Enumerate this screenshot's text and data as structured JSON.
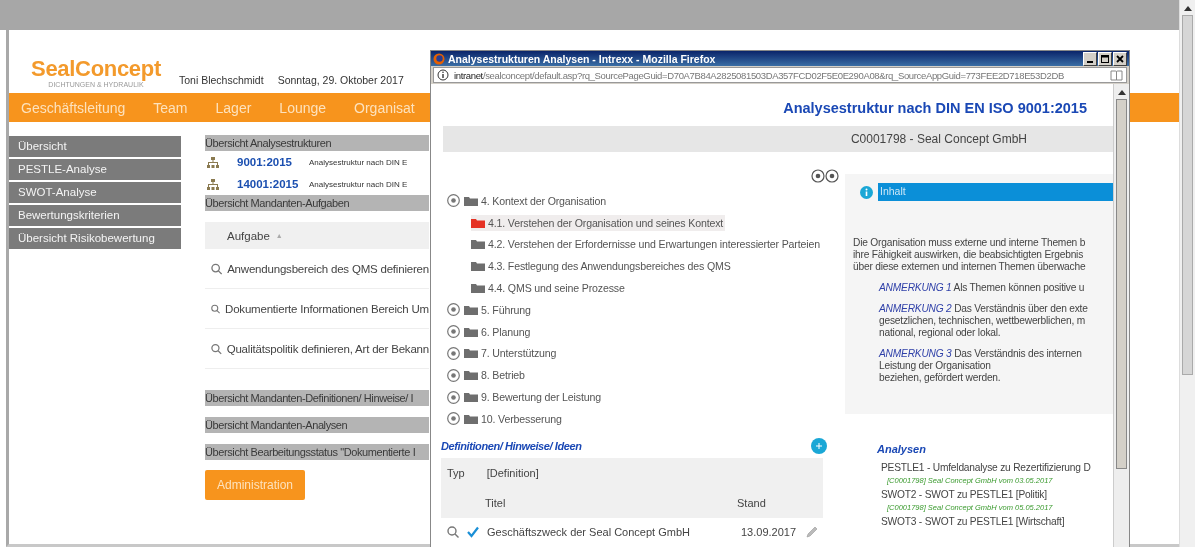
{
  "page": {
    "logo": {
      "name": "SealConcept",
      "tagline": "DICHTUNGEN & HYDRAULIK"
    },
    "user": "Toni Blechschmidt",
    "date": "Sonntag, 29. Oktober 2017",
    "nav": [
      "Geschäftsleitung",
      "Team",
      "Lager",
      "Lounge",
      "Organisat"
    ],
    "sidebar": [
      "Übersicht",
      "PESTLE-Analyse",
      "SWOT-Analyse",
      "Bewertungskriterien",
      "Übersicht Risikobewertung"
    ],
    "structures_header": "Übersicht Analysestrukturen",
    "structures": [
      {
        "code": "9001:2015",
        "description": "Analysestruktur nach DIN E"
      },
      {
        "code": "14001:2015",
        "description": "Analysestruktur nach DIN E"
      }
    ],
    "tasks_header": "Übersicht Mandanten-Aufgaben",
    "tasks_table": {
      "column": "Aufgabe",
      "sort_mark": "▲",
      "rows": [
        "Anwendungsbereich des QMS definieren",
        "Dokumentierte Informationen Bereich Um",
        "Qualitätspolitik definieren, Art der Bekann"
      ]
    },
    "more_headers": [
      "Übersicht Mandanten-Definitionen/ Hinweise/ I",
      "Übersicht Mandanten-Analysen",
      "Übersicht Bearbeitungsstatus \"Dokumentierte I"
    ],
    "admin_button": "Administration"
  },
  "popup": {
    "title": "Analysestrukturen Analysen - Intrexx - Mozilla Firefox",
    "url": "**intranet**/sealconcept/default.asp?rq_SourcePageGuid=D70A7B84A2825081503DA357FCD02F5E0E290A08&rq_SourceAppGuid=773FEE2D718E53D2DB",
    "heading": "Analysestruktur nach DIN EN ISO 9001:2015",
    "client": "C0001798 - Seal Concept GmbH",
    "tree": [
      {
        "label": "4. Kontext der Organisation",
        "selected": false,
        "children": [
          {
            "label": "4.1. Verstehen der Organisation und seines Kontext",
            "selected": true
          },
          {
            "label": "4.2. Verstehen der Erfordernisse und Erwartungen interessierter Parteien",
            "selected": false
          },
          {
            "label": "4.3. Festlegung des Anwendungsbereiches des QMS",
            "selected": false
          },
          {
            "label": "4.4. QMS und seine Prozesse",
            "selected": false
          }
        ]
      },
      {
        "label": "5. Führung",
        "selected": false
      },
      {
        "label": "6. Planung",
        "selected": false
      },
      {
        "label": "7. Unterstützung",
        "selected": false
      },
      {
        "label": "8. Betrieb",
        "selected": false
      },
      {
        "label": "9. Bewertung der Leistung",
        "selected": false
      },
      {
        "label": "10. Verbesserung",
        "selected": false
      }
    ],
    "definitions": {
      "title": "Definitionen/ Hinweise/ Ideen",
      "type_label": "Typ",
      "type_value": "[Definition]",
      "columns": [
        "Titel",
        "Stand"
      ],
      "rows": [
        {
          "title": "Geschäftszweck der Seal Concept GmbH",
          "date": "13.09.2017",
          "checked": true
        }
      ]
    },
    "info": {
      "title": "Inhalt",
      "paragraph": "Die Organisation muss externe und interne Themen b\nihre Fähigkeit auswirken, die beabsichtigten Ergebnis\nüber diese externen und internen Themen überwache",
      "notes": [
        "*ANMERKUNG 1* Als Themen können positive u",
        "*ANMERKUNG 2* Das Verständnis über den exte\ngesetzlichen, technischen, wettbewerblichen, m\nnational, regional oder lokal.",
        "*ANMERKUNG 3* Das Verständnis des internen\nLeistung der Organisation\nbeziehen, gefördert werden."
      ]
    },
    "analyses": {
      "title": "Analysen",
      "items": [
        {
          "name": "PESTLE1 - Umfeldanalyse zu Rezertifizierung D",
          "meta": "[C0001798] Seal Concept GmbH vom 03.05.2017"
        },
        {
          "name": "SWOT2 - SWOT zu PESTLE1 [Politik]",
          "meta": "[C0001798] Seal Concept GmbH vom 05.05.2017"
        },
        {
          "name": "SWOT3 - SWOT zu PESTLE1 [Wirtschaft]"
        }
      ]
    }
  }
}
